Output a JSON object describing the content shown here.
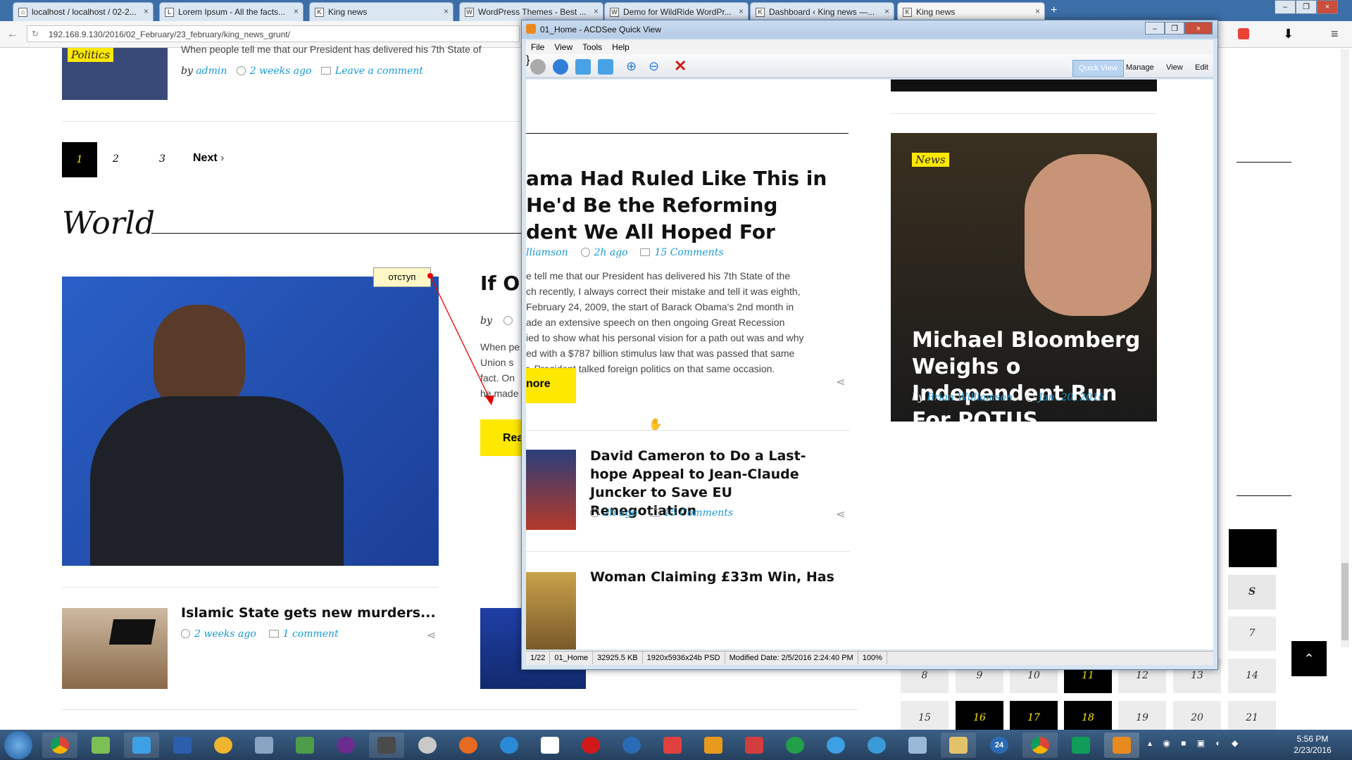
{
  "browser": {
    "tabs": [
      {
        "title": "localhost / localhost / 02-2..."
      },
      {
        "title": "Lorem Ipsum - All the facts..."
      },
      {
        "title": "King news"
      },
      {
        "title": "WordPress Themes - Best ..."
      },
      {
        "title": "Demo for WildRide WordPr..."
      },
      {
        "title": "Dashboard ‹ King news —..."
      },
      {
        "title": "King news"
      }
    ],
    "url": "192.168.9.130/2016/02_February/23_february/king_news_grunt/"
  },
  "page": {
    "top_post": {
      "category": "Politics",
      "excerpt": "When people tell me that our President has delivered his 7th State of",
      "by": "by",
      "author": "admin",
      "time": "2 weeks ago",
      "comments": "Leave a comment"
    },
    "pagination": {
      "pages": [
        "1",
        "2",
        "3"
      ],
      "next": "Next"
    },
    "world_heading": "World",
    "annotation": "отступ",
    "feature_post": {
      "title_fragment": "If O",
      "by": "by",
      "excerpt_lines": [
        "When pe",
        "Union s",
        "fact. On",
        "he made"
      ],
      "read_more_fragment": "Rea"
    },
    "small_posts": [
      {
        "title": "Islamic State gets new murders...",
        "time": "2 weeks ago",
        "comments": "1 comment"
      }
    ]
  },
  "quickview": {
    "title": "01_Home - ACDSee Quick View",
    "menu": [
      "File",
      "View",
      "Tools",
      "Help"
    ],
    "modes": [
      "Quick View",
      "Manage",
      "View",
      "Edit"
    ],
    "article": {
      "title_lines": [
        "ama Had Ruled Like This in",
        "He'd Be the Reforming",
        "dent We All Hoped For"
      ],
      "author_fragment": "lliamson",
      "time": "2h ago",
      "comments": "15 Comments",
      "body_lines": [
        "e tell me that our President has delivered his 7th State of the",
        "ch recently, I always correct their mistake and tell it was eighth,",
        "February 24, 2009, the start of Barack Obama's 2nd month in",
        "ade an extensive speech on then ongoing Great Recession",
        "ied to show what his personal vision for a path out was and why",
        "ed with a $787 billion stimulus law that was passed that same",
        "r. President talked foreign politics on that same occasion."
      ],
      "read_more": "nore"
    },
    "featured": {
      "category": "News",
      "title": "Michael Bloomberg Weighs o Independent Run For POTUS",
      "by": "by",
      "author": "Brian Williamson",
      "date": "Jan. 20, 2016"
    },
    "list": [
      {
        "title": "David Cameron to Do a Last-hope Appeal to Jean-Claude Juncker to Save EU Renegotiation",
        "time": "2h ago",
        "comments": "15 Comments"
      },
      {
        "title": "Woman Claiming £33m Win, Has"
      }
    ],
    "status": [
      "1/22",
      "01_Home",
      "32925.5 KB",
      "1920x5936x24b PSD",
      "Modified Date: 2/5/2016 2:24:40 PM",
      "100%"
    ]
  },
  "calendar": {
    "weekday_label": "S",
    "row1": [
      "7"
    ],
    "row2": [
      "8",
      "9",
      "10",
      "11",
      "12",
      "13",
      "14"
    ],
    "row3": [
      "15",
      "16",
      "17",
      "18",
      "19",
      "20",
      "21"
    ]
  },
  "taskbar": {
    "time": "5:56 PM",
    "date": "2/23/2016",
    "badge": "24"
  }
}
